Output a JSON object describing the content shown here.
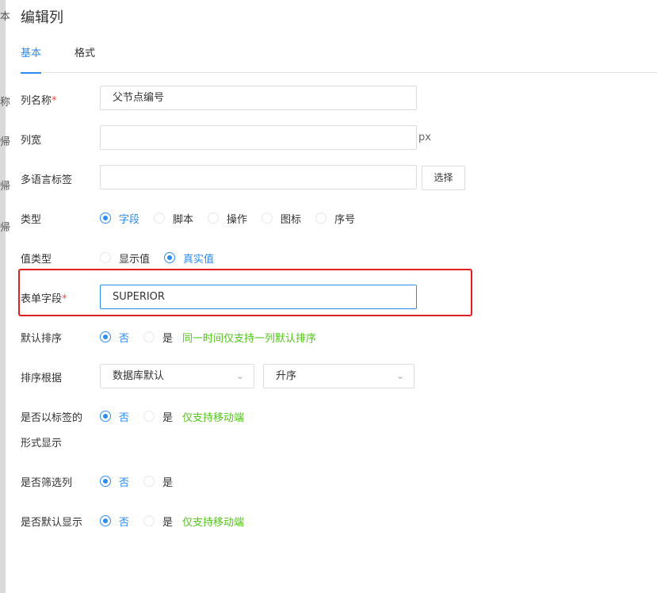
{
  "dialog": {
    "title": "编辑列"
  },
  "left_fragments": [
    "本",
    "称",
    "帰",
    "帰",
    "帰"
  ],
  "tabs": [
    {
      "label": "基本",
      "active": true
    },
    {
      "label": "格式",
      "active": false
    }
  ],
  "form": {
    "column_name": {
      "label": "列名称",
      "required_mark": "*",
      "value": "父节点编号"
    },
    "column_width": {
      "label": "列宽",
      "value": "",
      "suffix": "px"
    },
    "i18n_label": {
      "label": "多语言标签",
      "value": "",
      "button": "选择"
    },
    "type": {
      "label": "类型",
      "options": [
        "字段",
        "脚本",
        "操作",
        "图标",
        "序号"
      ],
      "selected": "字段"
    },
    "value_type": {
      "label": "值类型",
      "options": [
        "显示值",
        "真实值"
      ],
      "selected": "真实值"
    },
    "form_field": {
      "label": "表单字段",
      "required_mark": "*",
      "value": "SUPERIOR"
    },
    "default_sort": {
      "label": "默认排序",
      "options": [
        "否",
        "是"
      ],
      "selected": "否",
      "hint": "同一时间仅支持一列默认排序"
    },
    "sort_basis": {
      "label": "排序根据",
      "select1": "数据库默认",
      "select2": "升序"
    },
    "show_as_tag": {
      "label_line1": "是否以标签的",
      "label_line2": "形式显示",
      "options": [
        "否",
        "是"
      ],
      "selected": "否",
      "hint": "仅支持移动端"
    },
    "filter_column": {
      "label": "是否筛选列",
      "options": [
        "否",
        "是"
      ],
      "selected": "否"
    },
    "default_display": {
      "label": "是否默认显示",
      "options": [
        "否",
        "是"
      ],
      "selected": "否",
      "hint": "仅支持移动端"
    }
  },
  "colors": {
    "accent": "#2d8cf0",
    "hint": "#52c41a",
    "highlight": "#e02020",
    "required": "#e54d42"
  }
}
